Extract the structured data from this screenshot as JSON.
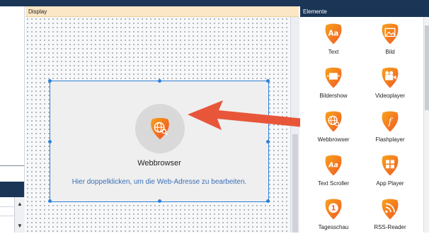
{
  "display": {
    "title": "Display",
    "widget": {
      "title": "Webbrowser",
      "hint": "Hier doppelklicken, um die Web-Adresse zu bearbeiten.",
      "icon": "web-browser-icon"
    }
  },
  "elements": {
    "title": "Elemente",
    "items": [
      {
        "label": "Text",
        "icon": "text-icon"
      },
      {
        "label": "Bild",
        "icon": "image-icon"
      },
      {
        "label": "Bildershow",
        "icon": "slideshow-icon"
      },
      {
        "label": "Videoplayer",
        "icon": "video-camera-icon"
      },
      {
        "label": "Webbrowser",
        "icon": "web-browser-icon"
      },
      {
        "label": "Flashplayer",
        "icon": "flash-icon"
      },
      {
        "label": "Text Scroller",
        "icon": "text-scroller-icon"
      },
      {
        "label": "App Player",
        "icon": "app-grid-icon"
      },
      {
        "label": "Tagesschau",
        "icon": "tagesschau-icon"
      },
      {
        "label": "RSS-Reader",
        "icon": "rss-icon"
      }
    ]
  },
  "colors": {
    "accent_orange": "#f15a24",
    "accent_yellow": "#f7a21b",
    "selection_blue": "#2f80d8",
    "panel_header": "#1b3556",
    "display_header": "#fbe7c6",
    "arrow": "#e8563a"
  }
}
